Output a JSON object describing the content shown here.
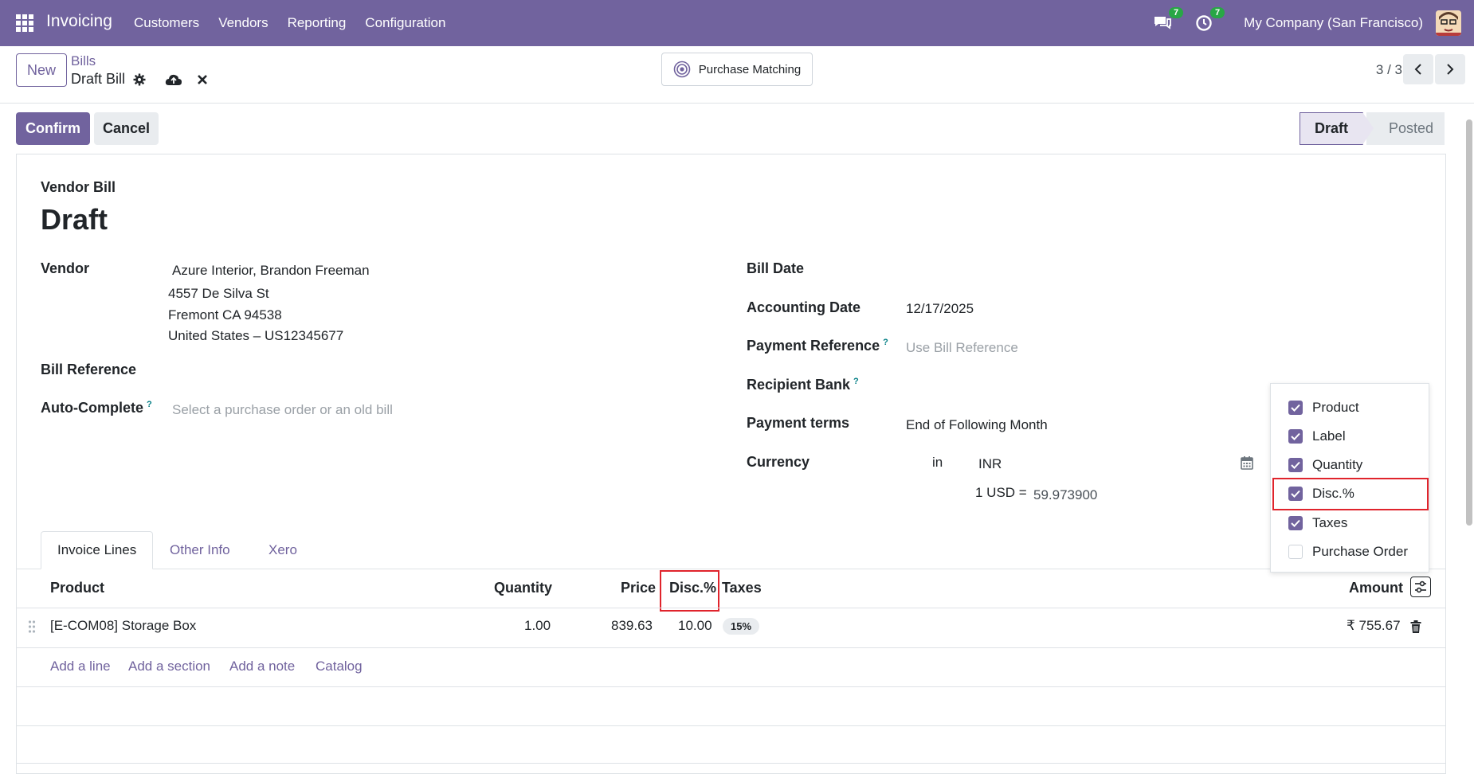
{
  "navbar": {
    "app_name": "Invoicing",
    "menu": [
      "Customers",
      "Vendors",
      "Reporting",
      "Configuration"
    ],
    "messages_count": "7",
    "activities_count": "7",
    "company": "My Company (San Francisco)"
  },
  "control_panel": {
    "new_label": "New",
    "breadcrumb_parent": "Bills",
    "breadcrumb_current": "Draft Bill",
    "purchase_matching_label": "Purchase Matching",
    "pager": "3 / 3"
  },
  "status_bar": {
    "confirm_label": "Confirm",
    "cancel_label": "Cancel",
    "stages": [
      "Draft",
      "Posted"
    ]
  },
  "form": {
    "doc_type": "Vendor Bill",
    "title": "Draft",
    "vendor_label": "Vendor",
    "vendor_name": "Azure Interior, Brandon Freeman",
    "vendor_address": [
      "4557 De Silva St",
      "Fremont CA 94538",
      "United States – US12345677"
    ],
    "bill_reference_label": "Bill Reference",
    "auto_complete_label": "Auto-Complete",
    "auto_complete_placeholder": "Select a purchase order or an old bill",
    "bill_date_label": "Bill Date",
    "accounting_date_label": "Accounting Date",
    "accounting_date_value": "12/17/2025",
    "payment_reference_label": "Payment Reference",
    "payment_reference_placeholder": "Use Bill Reference",
    "recipient_bank_label": "Recipient Bank",
    "payment_terms_label": "Payment terms",
    "payment_terms_value": "End of Following Month",
    "currency_label": "Currency",
    "currency_in": "in",
    "currency_value": "INR",
    "rate_label": "1 USD =",
    "rate_value": "59.973900",
    "help_mark": "?"
  },
  "tabs": [
    "Invoice Lines",
    "Other Info",
    "Xero"
  ],
  "table": {
    "headers": {
      "product": "Product",
      "quantity": "Quantity",
      "price": "Price",
      "discount": "Disc.%",
      "taxes": "Taxes",
      "amount": "Amount"
    },
    "rows": [
      {
        "product": "[E-COM08] Storage Box",
        "quantity": "1.00",
        "price": "839.63",
        "discount": "10.00",
        "tax": "15%",
        "amount": "₹ 755.67"
      }
    ],
    "add_links": [
      "Add a line",
      "Add a section",
      "Add a note",
      "Catalog"
    ]
  },
  "optional_columns": [
    {
      "label": "Product",
      "checked": true
    },
    {
      "label": "Label",
      "checked": true
    },
    {
      "label": "Quantity",
      "checked": true
    },
    {
      "label": "Disc.%",
      "checked": true
    },
    {
      "label": "Taxes",
      "checked": true
    },
    {
      "label": "Purchase Order",
      "checked": false
    }
  ],
  "colors": {
    "brand": "#71639e",
    "highlight": "#e0242c",
    "badge": "#28a745"
  }
}
